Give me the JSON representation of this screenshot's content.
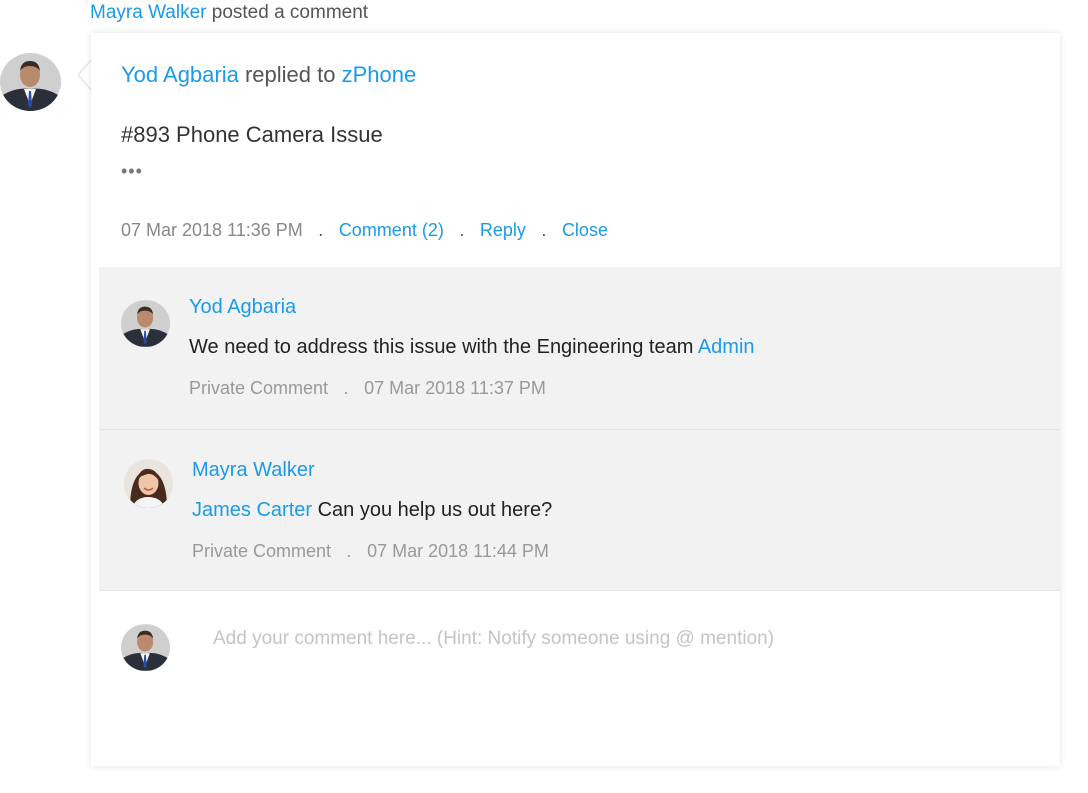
{
  "activity": {
    "actor": "Mayra Walker",
    "action": "posted a comment"
  },
  "post": {
    "author": "Yod Agbaria",
    "action": "replied to",
    "target": "zPhone",
    "ticket_title": "#893 Phone Camera Issue",
    "ellipsis": "•••",
    "timestamp": "07 Mar 2018 11:36 PM",
    "separator": ".",
    "comment_label": "Comment (2)",
    "reply_label": "Reply",
    "close_label": "Close"
  },
  "comments": [
    {
      "author": "Yod Agbaria",
      "text": "We need to address this issue with the Engineering team",
      "mention": "Admin",
      "visibility": "Private Comment",
      "separator": ".",
      "timestamp": "07 Mar 2018 11:37 PM"
    },
    {
      "author": "Mayra Walker",
      "mention": "James Carter",
      "text": "Can you help us out here?",
      "visibility": "Private Comment",
      "separator": ".",
      "timestamp": "07 Mar 2018 11:44 PM"
    }
  ],
  "composer": {
    "placeholder": "Add your comment here... (Hint: Notify someone using @ mention)"
  },
  "colors": {
    "link": "#1a9be6",
    "comment_bg": "#f2f2f2"
  }
}
